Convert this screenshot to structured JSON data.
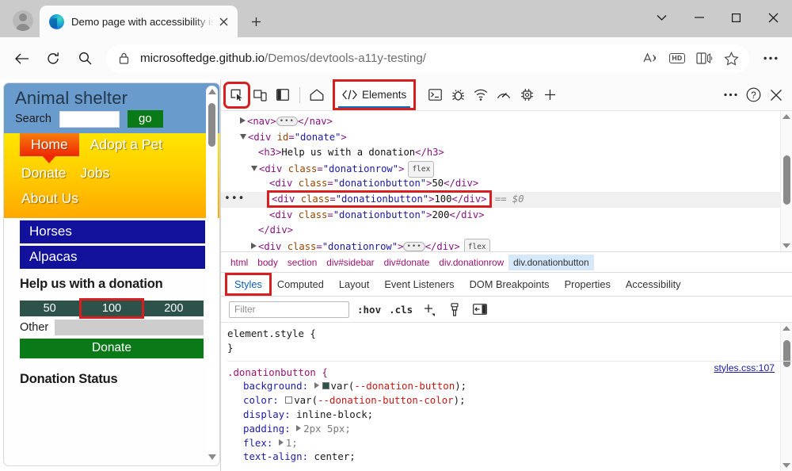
{
  "browser": {
    "tab": {
      "title": "Demo page with accessibility issu",
      "close_label": "×"
    },
    "new_tab_label": "+",
    "window_controls": {
      "tab_search": "tab-search",
      "minimize": "—",
      "maximize": "□",
      "close": "×"
    },
    "address": {
      "url_bold": "microsoftedge.github.io",
      "url_rest": "/Demos/devtools-a11y-testing/",
      "lock_icon": "lock-icon"
    },
    "omnibox_icons": [
      "read-aloud-icon",
      "hd-badge-icon",
      "immersive-reader-icon",
      "favorite-star-icon"
    ],
    "hd_label": "HD",
    "settings_label": "…"
  },
  "webpage": {
    "site_title": "Animal shelter",
    "search_label": "Search",
    "search_value": "",
    "go_button": "go",
    "nav": {
      "home": "Home",
      "adopt": "Adopt a Pet",
      "donate": "Donate",
      "jobs": "Jobs",
      "about": "About Us"
    },
    "animals": [
      "Horses",
      "Alpacas"
    ],
    "donation_heading": "Help us with a donation",
    "donation_amounts": [
      "50",
      "100",
      "200"
    ],
    "other_label": "Other",
    "other_value": "",
    "donate_button": "Donate",
    "status_heading": "Donation Status",
    "colors": {
      "header_bg": "#6a9bcd",
      "nav_gradient_start": "#ffe500",
      "nav_gradient_end": "#ffab00",
      "home_tab": "#ef2705",
      "animal_button": "#11119c",
      "donation_button": "#2d5249",
      "donate_green": "#0a7a18"
    }
  },
  "devtools": {
    "toolbar": {
      "inspect": "inspect-element-icon",
      "device": "device-emulation-icon",
      "dock": "dock-side-icon",
      "home": "home-icon",
      "elements_tab": "Elements",
      "console": "console-icon",
      "debugger": "debugger-icon",
      "network": "network-icon",
      "performance": "performance-icon",
      "memory": "memory-icon",
      "add_tab": "+",
      "more": "…",
      "help": "?",
      "close": "×"
    },
    "dom": [
      {
        "indent": 1,
        "marker": "right",
        "parts": [
          {
            "t": "tg",
            "v": "<nav>"
          },
          {
            "t": "ellip",
            "v": "…"
          },
          {
            "t": "tg",
            "v": "</nav>"
          }
        ]
      },
      {
        "indent": 1,
        "marker": "down",
        "parts": [
          {
            "t": "tg",
            "v": "<div "
          },
          {
            "t": "at",
            "v": "id"
          },
          {
            "t": "tg",
            "v": "="
          },
          {
            "t": "av",
            "v": "\"donate\""
          },
          {
            "t": "tg",
            "v": ">"
          }
        ]
      },
      {
        "indent": 2,
        "marker": "none",
        "parts": [
          {
            "t": "tg",
            "v": "<h3>"
          },
          {
            "t": "tx",
            "v": "Help us with a donation"
          },
          {
            "t": "tg",
            "v": "</h3>"
          }
        ]
      },
      {
        "indent": 2,
        "marker": "down",
        "parts": [
          {
            "t": "tg",
            "v": "<div "
          },
          {
            "t": "at",
            "v": "class"
          },
          {
            "t": "tg",
            "v": "="
          },
          {
            "t": "av",
            "v": "\"donationrow\""
          },
          {
            "t": "tg",
            "v": ">"
          },
          {
            "t": "flex",
            "v": "flex"
          }
        ]
      },
      {
        "indent": 3,
        "marker": "none",
        "parts": [
          {
            "t": "tg",
            "v": "<div "
          },
          {
            "t": "at",
            "v": "class"
          },
          {
            "t": "tg",
            "v": "="
          },
          {
            "t": "av",
            "v": "\"donationbutton\""
          },
          {
            "t": "tg",
            "v": ">"
          },
          {
            "t": "tx",
            "v": "50"
          },
          {
            "t": "tg",
            "v": "</div>"
          }
        ]
      },
      {
        "indent": 3,
        "marker": "none",
        "selected": true,
        "boxed": true,
        "dots": true,
        "parts": [
          {
            "t": "tg",
            "v": "<div "
          },
          {
            "t": "at",
            "v": "class"
          },
          {
            "t": "tg",
            "v": "="
          },
          {
            "t": "av",
            "v": "\"donationbutton\""
          },
          {
            "t": "tg",
            "v": ">"
          },
          {
            "t": "tx",
            "v": "100"
          },
          {
            "t": "tg",
            "v": "</div>"
          }
        ],
        "suffix": "== $0"
      },
      {
        "indent": 3,
        "marker": "none",
        "parts": [
          {
            "t": "tg",
            "v": "<div "
          },
          {
            "t": "at",
            "v": "class"
          },
          {
            "t": "tg",
            "v": "="
          },
          {
            "t": "av",
            "v": "\"donationbutton\""
          },
          {
            "t": "tg",
            "v": ">"
          },
          {
            "t": "tx",
            "v": "200"
          },
          {
            "t": "tg",
            "v": "</div>"
          }
        ]
      },
      {
        "indent": 2,
        "marker": "none",
        "parts": [
          {
            "t": "tg",
            "v": "</div>"
          }
        ]
      },
      {
        "indent": 2,
        "marker": "right",
        "parts": [
          {
            "t": "tg",
            "v": "<div "
          },
          {
            "t": "at",
            "v": "class"
          },
          {
            "t": "tg",
            "v": "="
          },
          {
            "t": "av",
            "v": "\"donationrow\""
          },
          {
            "t": "tg",
            "v": ">"
          },
          {
            "t": "ellip",
            "v": "…"
          },
          {
            "t": "tg",
            "v": "</div>"
          },
          {
            "t": "flex",
            "v": "flex"
          }
        ]
      }
    ],
    "breadcrumbs": [
      "html",
      "body",
      "section",
      "div#sidebar",
      "div#donate",
      "div.donationrow",
      "div.donationbutton"
    ],
    "breadcrumb_selected": "div.donationbutton",
    "panel_tabs": [
      "Styles",
      "Computed",
      "Layout",
      "Event Listeners",
      "DOM Breakpoints",
      "Properties",
      "Accessibility"
    ],
    "panel_tab_active": "Styles",
    "styles_toolbar": {
      "filter_placeholder": "Filter",
      "hov": ":hov",
      "cls": ".cls",
      "new_rule": "+",
      "brush": "element-classes-icon",
      "toggle": "computed-sidebar-icon"
    },
    "rules": [
      {
        "selector": "element.style {",
        "close": "}",
        "source": "",
        "declarations": []
      },
      {
        "selector": ".donationbutton {",
        "close": "",
        "source": "styles.css:107",
        "declarations": [
          {
            "prop": "background",
            "expand": true,
            "swatch": "#2d5249",
            "value": "var(--donation-button);",
            "var": "--donation-button"
          },
          {
            "prop": "color",
            "expand": false,
            "swatch": "#ffffff",
            "value": "var(--donation-button-color);",
            "var": "--donation-button-color"
          },
          {
            "prop": "display",
            "value": "inline-block;"
          },
          {
            "prop": "padding",
            "expand": true,
            "value": "2px 5px;",
            "numeric": true
          },
          {
            "prop": "flex",
            "expand": true,
            "value": "1;",
            "numeric": true
          },
          {
            "prop": "text-align",
            "value": "center;"
          }
        ]
      }
    ]
  }
}
